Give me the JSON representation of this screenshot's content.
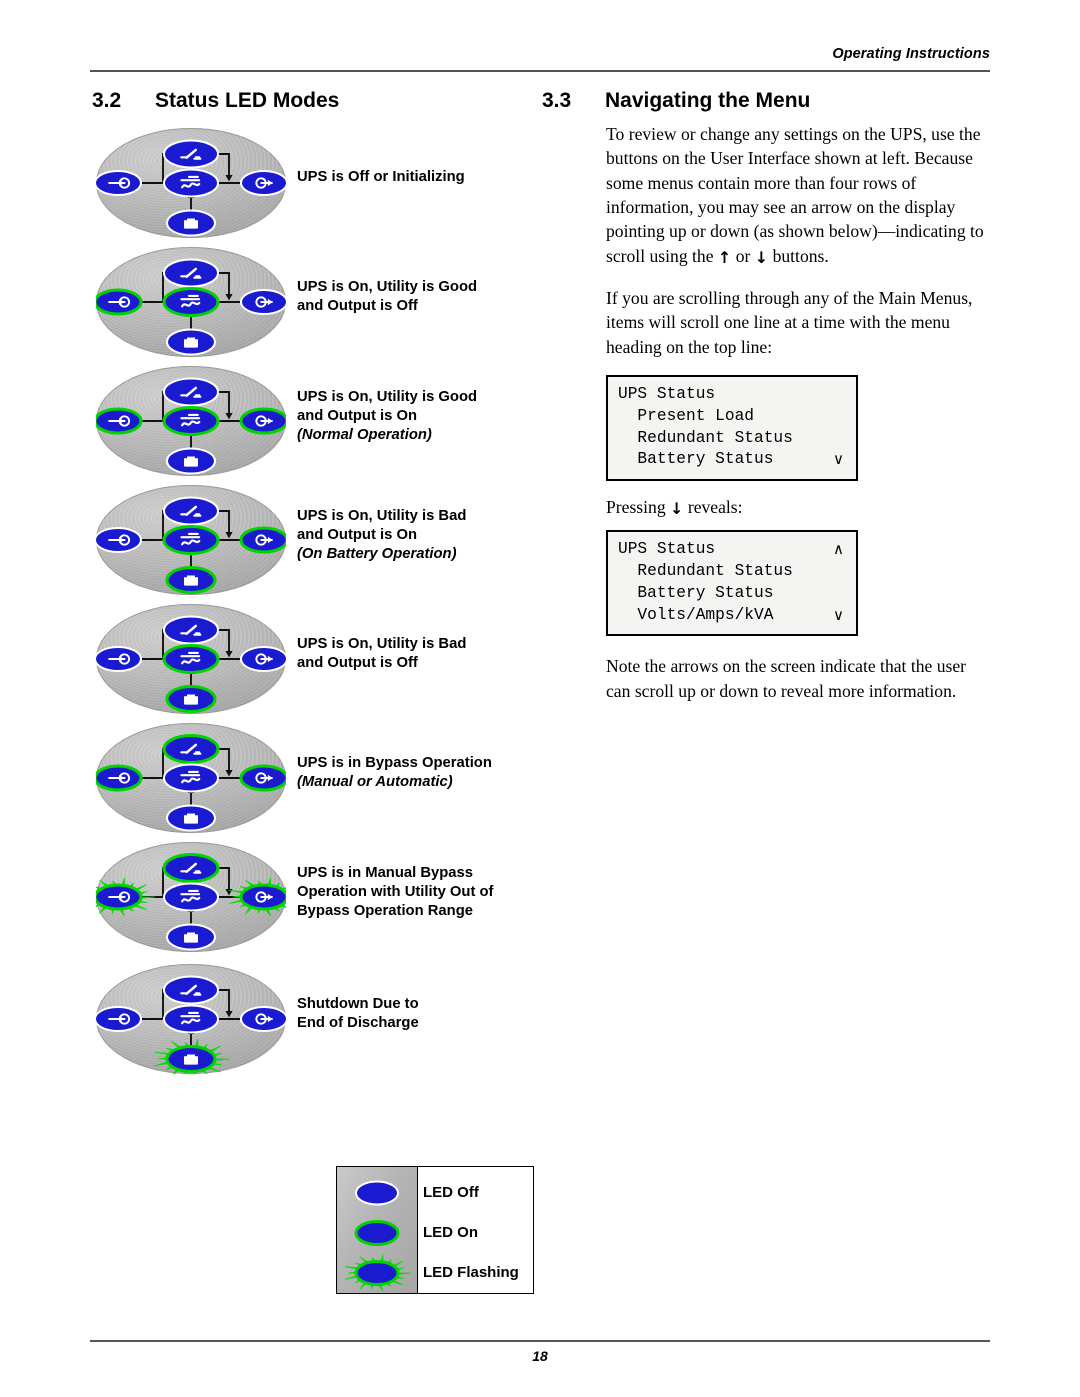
{
  "header": {
    "running_head": "Operating Instructions"
  },
  "footer": {
    "page_number": "18"
  },
  "sections": {
    "left": {
      "number": "3.2",
      "title": "Status LED Modes"
    },
    "right": {
      "number": "3.3",
      "title": "Navigating the Menu"
    }
  },
  "colors": {
    "led_body": "#1a1ad0",
    "led_on_ring": "#00d400",
    "led_off_ring": "#ffffff",
    "panel_gray": "#b4b4b4",
    "flash_ray": "#00e000"
  },
  "led_panel": {
    "positions": [
      "input",
      "bypass",
      "inverter",
      "output",
      "battery"
    ],
    "icon_names": {
      "input": "input-led-icon",
      "bypass": "bypass-switch-led-icon",
      "inverter": "inverter-led-icon",
      "output": "output-led-icon",
      "battery": "battery-led-icon"
    }
  },
  "led_modes": [
    {
      "label_lines": [
        "UPS is Off or Initializing"
      ],
      "italic_line": "",
      "leds": {
        "input": "off",
        "bypass": "off",
        "inverter": "off",
        "output": "off",
        "battery": "off"
      }
    },
    {
      "label_lines": [
        "UPS is On, Utility is Good",
        "and Output is Off"
      ],
      "italic_line": "",
      "leds": {
        "input": "on",
        "bypass": "off",
        "inverter": "on",
        "output": "off",
        "battery": "off"
      }
    },
    {
      "label_lines": [
        "UPS is On, Utility is Good",
        "and Output is On"
      ],
      "italic_line": "(Normal Operation)",
      "leds": {
        "input": "on",
        "bypass": "off",
        "inverter": "on",
        "output": "on",
        "battery": "off"
      }
    },
    {
      "label_lines": [
        "UPS is On, Utility is Bad",
        "and Output is On"
      ],
      "italic_line": "(On Battery Operation)",
      "leds": {
        "input": "off",
        "bypass": "off",
        "inverter": "on",
        "output": "on",
        "battery": "on"
      }
    },
    {
      "label_lines": [
        "UPS is On, Utility is Bad",
        "and Output is Off"
      ],
      "italic_line": "",
      "leds": {
        "input": "off",
        "bypass": "off",
        "inverter": "on",
        "output": "off",
        "battery": "on"
      }
    },
    {
      "label_lines": [
        "UPS is in Bypass Operation"
      ],
      "italic_line": "(Manual or Automatic)",
      "leds": {
        "input": "on",
        "bypass": "on",
        "inverter": "off",
        "output": "on",
        "battery": "off"
      }
    },
    {
      "label_lines": [
        "UPS is in Manual Bypass",
        "Operation with Utility Out of",
        "Bypass Operation Range"
      ],
      "italic_line": "",
      "leds": {
        "input": "flashing",
        "bypass": "on",
        "inverter": "off",
        "output": "flashing",
        "battery": "off"
      }
    },
    {
      "label_lines": [
        "Shutdown Due to",
        "End of Discharge"
      ],
      "italic_line": "",
      "leds": {
        "input": "off",
        "bypass": "off",
        "inverter": "off",
        "output": "off",
        "battery": "flashing"
      }
    }
  ],
  "legend": {
    "rows": [
      {
        "state": "off",
        "label": "LED Off"
      },
      {
        "state": "on",
        "label": "LED On"
      },
      {
        "state": "flashing",
        "label": "LED Flashing"
      }
    ]
  },
  "right_column": {
    "paragraph_1_a": "To review or change any settings on the UPS, use the buttons on the User Interface shown at left. Because some menus contain more than four rows of information, you may see an arrow on the display pointing up or down (as shown below)—indicating to scroll using the ",
    "paragraph_1_up": "↑",
    "paragraph_1_mid": " or ",
    "paragraph_1_down": "↓",
    "paragraph_1_b": " buttons.",
    "paragraph_2": "If you are scrolling through any of the Main Menus, items will scroll one line at a time with the menu heading on the top line:",
    "press_a": "Pressing ",
    "press_arrow": "↓",
    "press_b": " reveals:",
    "paragraph_3": "Note the arrows on the screen indicate that the user can scroll up or down to reveal more information.",
    "lcd_screens": [
      {
        "lines": [
          {
            "text": "UPS Status",
            "caret": ""
          },
          {
            "text": "  Present Load",
            "caret": ""
          },
          {
            "text": "  Redundant Status",
            "caret": ""
          },
          {
            "text": "  Battery Status",
            "caret": "∨"
          }
        ]
      },
      {
        "lines": [
          {
            "text": "UPS Status",
            "caret": "∧"
          },
          {
            "text": "  Redundant Status",
            "caret": ""
          },
          {
            "text": "  Battery Status",
            "caret": ""
          },
          {
            "text": "  Volts/Amps/kVA",
            "caret": "∨"
          }
        ]
      }
    ]
  }
}
